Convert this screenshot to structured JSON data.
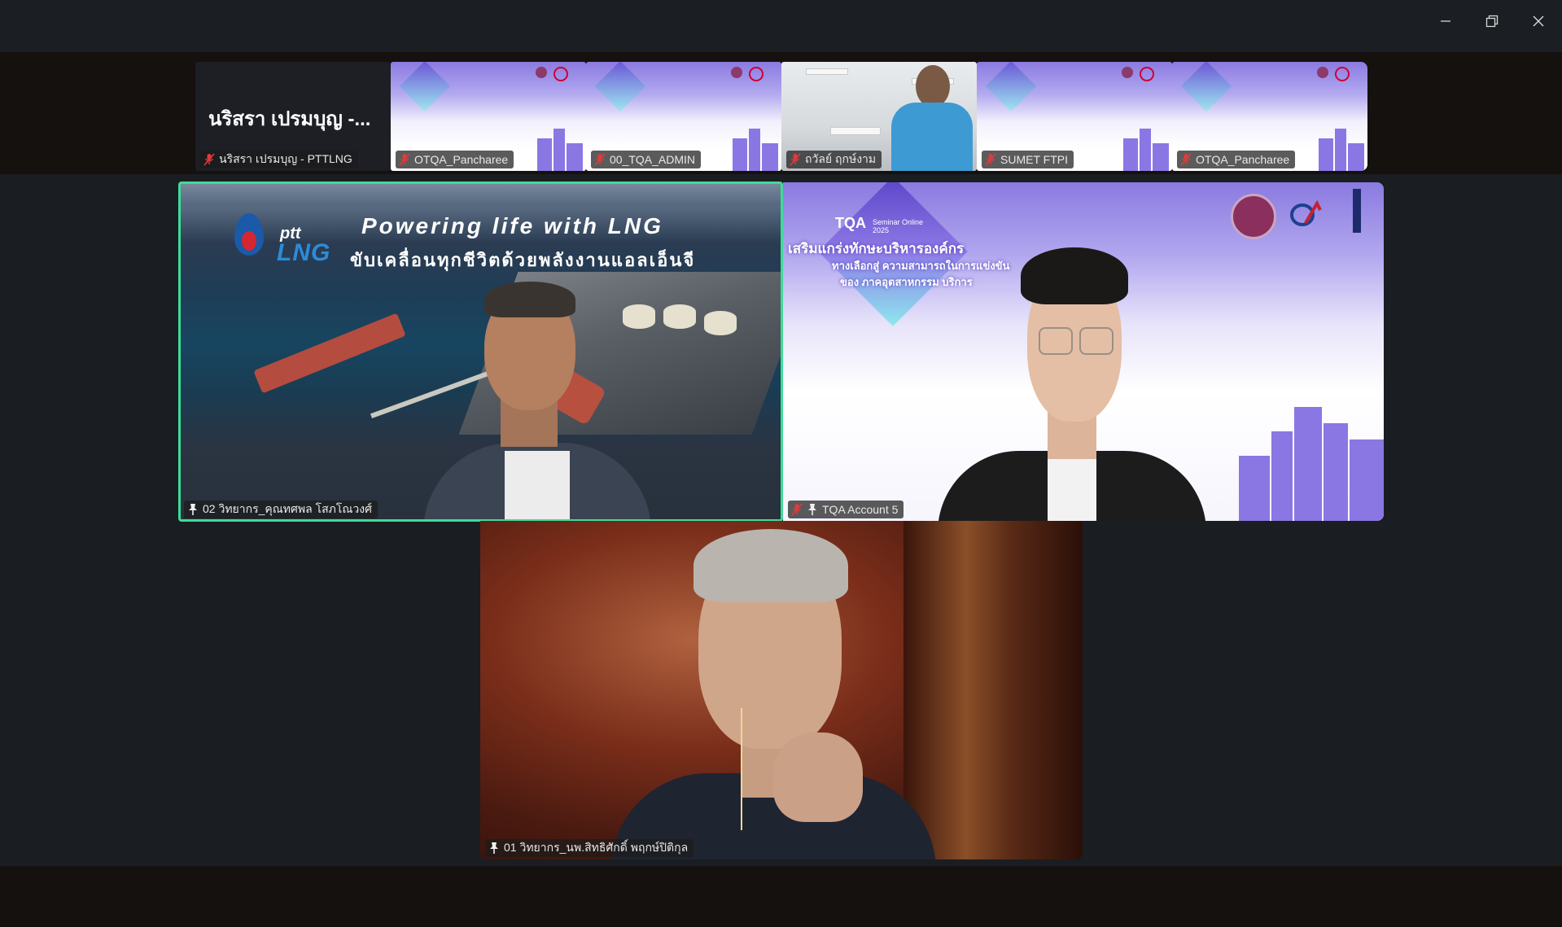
{
  "window": {
    "minimize_label": "Minimize",
    "restore_label": "Restore",
    "close_label": "Close"
  },
  "strip": {
    "first_tile": {
      "display_name": "นริสรา เปรมบุญ -...",
      "label": "นริสรา เปรมบุญ - PTTLNG"
    },
    "tiles": [
      {
        "label": "OTQA_Pancharee"
      },
      {
        "label": "00_TQA_ADMIN"
      },
      {
        "label": "ถวัลย์ ฤกษ์งาม"
      },
      {
        "label": "SUMET FTPI"
      },
      {
        "label": "OTQA_Pancharee"
      }
    ]
  },
  "gallery": {
    "speaker_left": {
      "label": "02 วิทยากร_คุณทศพล โสภโณวงศ์",
      "banner_en": "Powering life with LNG",
      "banner_th": "ขับเคลื่อนทุกชีวิตด้วยพลังงานแอลเอ็นจี",
      "brand_small": "ptt",
      "brand_big": "LNG"
    },
    "speaker_right": {
      "label": "TQA Account 5",
      "banner_title": "TQA",
      "banner_sub": "Seminar Online 2025",
      "banner_line1": "เสริมแกร่งทักษะบริหารองค์กร",
      "banner_line2": "ทางเลือกสู่ ความสามารถในการแข่งขัน",
      "banner_line3": "ของ ภาคอุตสาหกรรม บริการ"
    },
    "speaker_bottom": {
      "label": "01 วิทยากร_นพ.สิทธิศักดิ์ พฤกษ์ปิติกุล"
    }
  },
  "colors": {
    "active_speaker_border": "#3ddc97",
    "mic_muted": "#e03b3b",
    "tqa_purple": "#8b77e4"
  }
}
